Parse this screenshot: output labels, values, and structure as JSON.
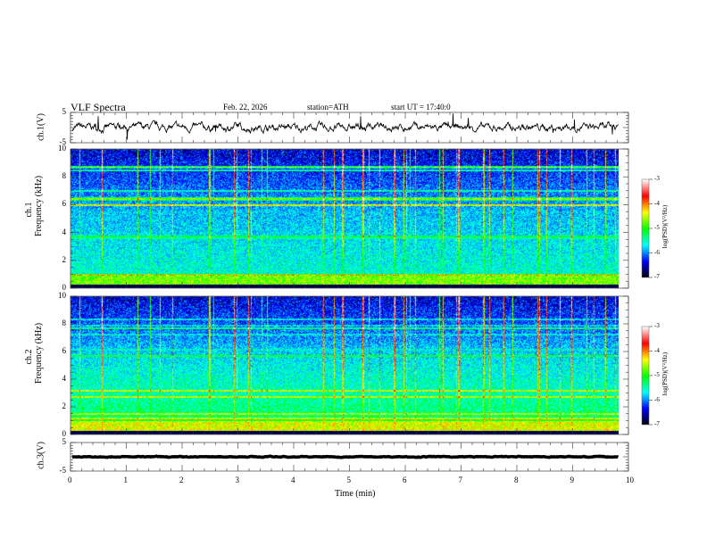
{
  "header": {
    "title": "VLF Spectra",
    "date": "Feb. 22, 2026",
    "station": "station=ATH",
    "start_ut": "start UT =  17:40:0"
  },
  "chart_data": [
    {
      "type": "line",
      "ylabel": "ch.1(V)",
      "ylim": [
        -5,
        5
      ],
      "yticks": [
        "5",
        "-5"
      ],
      "xlim": [
        0,
        10
      ],
      "data_end_min": 9.82,
      "baseline_v": 0
    },
    {
      "type": "heatmap",
      "ylabel_top": "ch.1",
      "ylabel_bottom": "Frequency (kHz)",
      "ylim": [
        0,
        10
      ],
      "yticks": [
        "0",
        "2",
        "4",
        "6",
        "8",
        "10"
      ],
      "xlim": [
        0,
        10
      ],
      "colorbar": {
        "label": "log(PSD)(V²/Hz)",
        "range": [
          -7,
          -3
        ],
        "ticks": [
          "-3",
          "-4",
          "-5",
          "-6",
          "-7"
        ],
        "colormap": [
          "#000000",
          "#0000ff",
          "#00ffff",
          "#00ff00",
          "#ffff00",
          "#ff0000",
          "#ffffff"
        ]
      }
    },
    {
      "type": "heatmap",
      "ylabel_top": "ch.2",
      "ylabel_bottom": "Frequency (kHz)",
      "ylim": [
        0,
        10
      ],
      "yticks": [
        "0",
        "2",
        "4",
        "6",
        "8",
        "10"
      ],
      "xlim": [
        0,
        10
      ],
      "colorbar": {
        "label": "log(PSD)(V²/Hz)",
        "range": [
          -7,
          -3
        ],
        "ticks": [
          "-3",
          "-4",
          "-5",
          "-6",
          "-7"
        ]
      }
    },
    {
      "type": "line",
      "ylabel": "ch.3(V)",
      "ylim": [
        -5,
        5
      ],
      "yticks": [
        "5",
        "-5"
      ],
      "xlim": [
        0,
        10
      ],
      "baseline_v": 0
    }
  ],
  "xaxis": {
    "label": "Time (min)",
    "ticks": [
      "0",
      "1",
      "2",
      "3",
      "4",
      "5",
      "6",
      "7",
      "8",
      "9",
      "10"
    ]
  }
}
